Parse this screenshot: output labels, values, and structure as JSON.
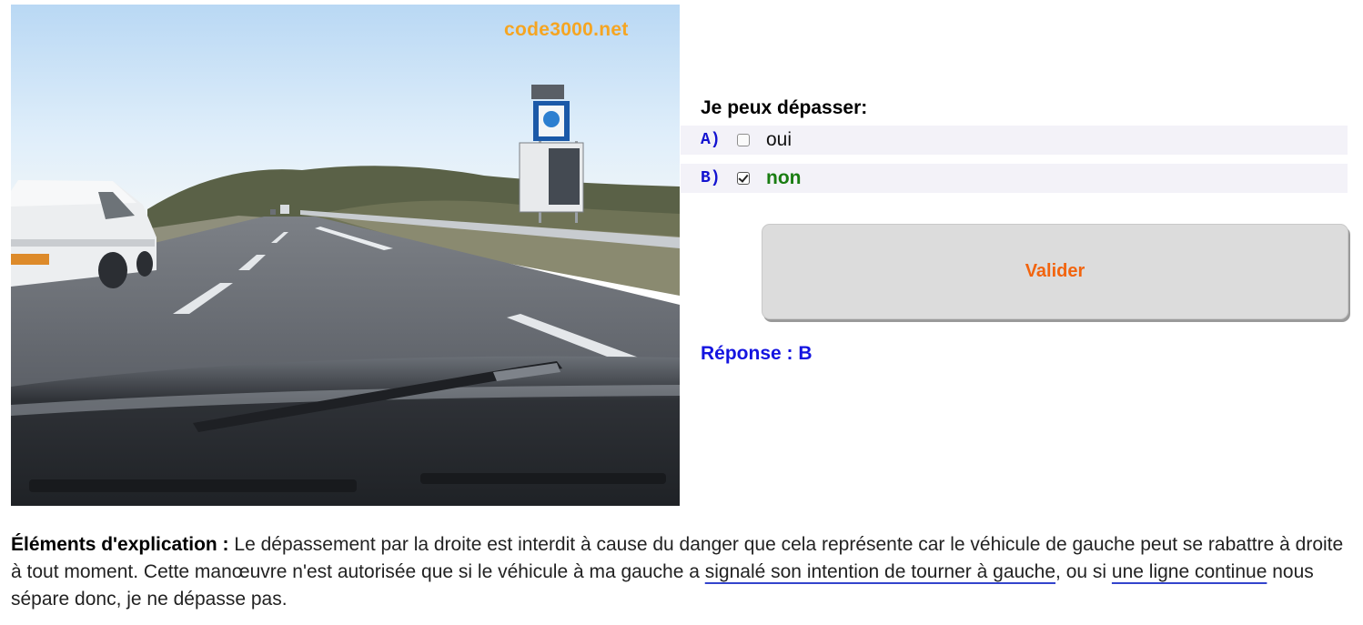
{
  "photo": {
    "watermark": "code3000.net"
  },
  "question": {
    "title": "Je peux dépasser:",
    "options": [
      {
        "letter": "A)",
        "text": "oui",
        "checked": false
      },
      {
        "letter": "B)",
        "text": "non",
        "checked": true
      }
    ]
  },
  "validate_label": "Valider",
  "answer_text": "Réponse : B",
  "explanation": {
    "label": "Éléments d'explication :",
    "part1": " Le dépassement par la droite est interdit à cause du danger que cela représente car le véhicule de gauche peut se rabattre à droite à tout moment. Cette manœuvre n'est autorisée que si le véhicule à ma gauche a ",
    "link1": "signalé son intention de tourner à gauche",
    "part2": ", ou si ",
    "link2": "une ligne continue",
    "part3": " nous sépare donc, je ne dépasse pas."
  },
  "colors": {
    "option_letter": "#1313d0",
    "correct": "#1a7d12",
    "validate_text": "#f2640e",
    "answer": "#1414e0",
    "watermark": "#f5a522"
  }
}
